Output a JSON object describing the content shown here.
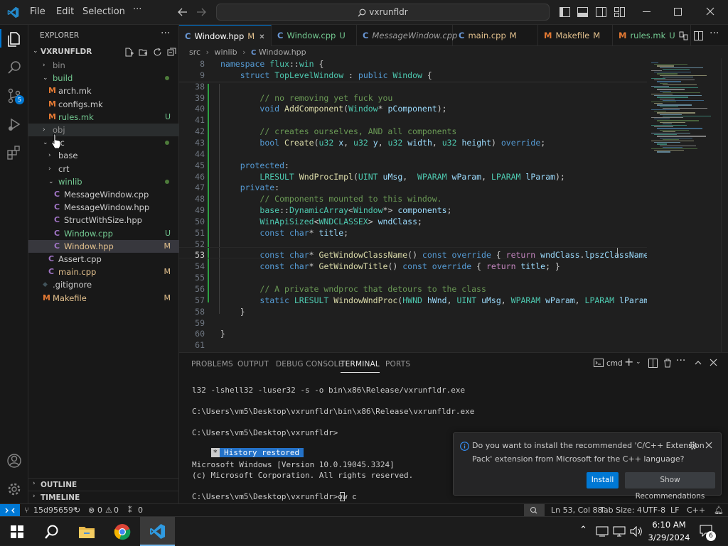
{
  "menu": {
    "file": "File",
    "edit": "Edit",
    "selection": "Selection",
    "more": "···"
  },
  "command_center": "vxrunfldr",
  "sidebar": {
    "title": "EXPLORER",
    "root": "VXRUNFLDR",
    "tree": [
      {
        "label": "bin",
        "type": "folder",
        "open": false,
        "indent": 1,
        "color": "#8c8c8c"
      },
      {
        "label": "build",
        "type": "folder",
        "open": true,
        "indent": 1,
        "color": "#73c991",
        "dot": true
      },
      {
        "label": "arch.mk",
        "type": "file",
        "icon": "M",
        "indent": 2,
        "color": "#cccccc"
      },
      {
        "label": "configs.mk",
        "type": "file",
        "icon": "M",
        "indent": 2,
        "color": "#cccccc"
      },
      {
        "label": "rules.mk",
        "type": "file",
        "icon": "M",
        "indent": 2,
        "color": "#73c991",
        "badge": "U"
      },
      {
        "label": "obj",
        "type": "folder",
        "open": false,
        "indent": 1,
        "color": "#8c8c8c",
        "hover": true
      },
      {
        "label": "src",
        "type": "folder",
        "open": true,
        "indent": 1,
        "color": "#cccccc",
        "dot": true
      },
      {
        "label": "base",
        "type": "folder",
        "open": false,
        "indent": 2,
        "color": "#cccccc"
      },
      {
        "label": "crt",
        "type": "folder",
        "open": false,
        "indent": 2,
        "color": "#cccccc"
      },
      {
        "label": "winlib",
        "type": "folder",
        "open": true,
        "indent": 2,
        "color": "#73c991",
        "dot": true
      },
      {
        "label": "MessageWindow.cpp",
        "type": "file",
        "icon": "C",
        "indent": 3,
        "color": "#cccccc"
      },
      {
        "label": "MessageWindow.hpp",
        "type": "file",
        "icon": "C",
        "indent": 3,
        "color": "#cccccc"
      },
      {
        "label": "StructWithSize.hpp",
        "type": "file",
        "icon": "C",
        "indent": 3,
        "color": "#cccccc"
      },
      {
        "label": "Window.cpp",
        "type": "file",
        "icon": "C",
        "indent": 3,
        "color": "#73c991",
        "badge": "U"
      },
      {
        "label": "Window.hpp",
        "type": "file",
        "icon": "C",
        "indent": 3,
        "color": "#e2c08d",
        "badge": "M",
        "selected": true
      },
      {
        "label": "Assert.cpp",
        "type": "file",
        "icon": "C",
        "indent": 2,
        "color": "#cccccc"
      },
      {
        "label": "main.cpp",
        "type": "file",
        "icon": "C",
        "indent": 2,
        "color": "#e2c08d",
        "badge": "M"
      },
      {
        "label": ".gitignore",
        "type": "file",
        "icon": "◆",
        "indent": 1,
        "color": "#cccccc"
      },
      {
        "label": "Makefile",
        "type": "file",
        "icon": "M",
        "indent": 1,
        "color": "#e2c08d",
        "badge": "M"
      }
    ],
    "outline": "OUTLINE",
    "timeline": "TIMELINE"
  },
  "tabs": [
    {
      "label": "Window.hpp",
      "badge": "M",
      "icon": "C",
      "active": true,
      "italic": false,
      "color": "#e2c08d"
    },
    {
      "label": "Window.cpp",
      "badge": "U",
      "icon": "C",
      "active": false,
      "italic": false,
      "color": "#73c991"
    },
    {
      "label": "MessageWindow.cpp",
      "badge": "",
      "icon": "C",
      "active": false,
      "italic": true,
      "color": "#9d9d9d"
    },
    {
      "label": "main.cpp",
      "badge": "M",
      "icon": "C",
      "active": false,
      "italic": false,
      "color": "#e2c08d"
    },
    {
      "label": "Makefile",
      "badge": "M",
      "icon": "M",
      "active": false,
      "italic": false,
      "color": "#e2c08d"
    },
    {
      "label": "rules.mk",
      "badge": "U",
      "icon": "M",
      "active": false,
      "italic": false,
      "color": "#73c991"
    }
  ],
  "breadcrumb": [
    "src",
    "winlib",
    "Window.hpp"
  ],
  "code_lines": [
    {
      "n": "8",
      "html": "<span class='k'>namespace</span> <span class='t'>flux</span>::<span class='t'>win</span> {"
    },
    {
      "n": "9",
      "html": "    <span class='k'>struct</span> <span class='t'>TopLevelWindow</span> : <span class='k'>public</span> <span class='t'>Window</span> {"
    },
    {
      "n": "38",
      "html": ""
    },
    {
      "n": "39",
      "html": "        <span class='c'>// no removing yet fuck you</span>"
    },
    {
      "n": "40",
      "html": "        <span class='k'>void</span> <span class='f'>AddComponent</span>(<span class='t'>Window</span>* <span class='v'>pComponent</span>);"
    },
    {
      "n": "41",
      "html": ""
    },
    {
      "n": "42",
      "html": "        <span class='c'>// creates ourselves, AND all components</span>"
    },
    {
      "n": "43",
      "html": "        <span class='k'>bool</span> <span class='f'>Create</span>(<span class='t'>u32</span> <span class='v'>x</span>, <span class='t'>u32</span> <span class='v'>y</span>, <span class='t'>u32</span> <span class='v'>width</span>, <span class='t'>u32</span> <span class='v'>height</span>) <span class='k'>override</span>;"
    },
    {
      "n": "44",
      "html": ""
    },
    {
      "n": "45",
      "html": "    <span class='k'>protected</span>:"
    },
    {
      "n": "46",
      "html": "        <span class='t'>LRESULT</span> <span class='f'>WndProcImpl</span>(<span class='t'>UINT</span> <span class='v'>uMsg</span>,  <span class='t'>WPARAM</span> <span class='v'>wParam</span>, <span class='t'>LPARAM</span> <span class='v'>lParam</span>);"
    },
    {
      "n": "47",
      "html": "    <span class='k'>private</span>:"
    },
    {
      "n": "48",
      "html": "        <span class='c'>// Components mounted to this window.</span>"
    },
    {
      "n": "49",
      "html": "        <span class='t'>base</span>::<span class='t'>DynamicArray</span>&lt;<span class='t'>Window</span>*&gt; <span class='v'>components</span>;"
    },
    {
      "n": "50",
      "html": "        <span class='t'>WinApiSized</span>&lt;<span class='t'>WNDCLASSEX</span>&gt; <span class='v'>wndClass</span>;"
    },
    {
      "n": "51",
      "html": "        <span class='k'>const</span> <span class='k'>char</span>* <span class='v'>title</span>;"
    },
    {
      "n": "52",
      "html": ""
    },
    {
      "n": "53",
      "html": "        <span class='k'>const</span> <span class='k'>char</span>* <span class='f'>GetWindowClassName</span>() <span class='k'>const</span> <span class='k'>override</span> { <span class='p'>return</span> <span class='v'>wndClass</span>.<span class='v'>lpszClassName</span>; }"
    },
    {
      "n": "54",
      "html": "        <span class='k'>const</span> <span class='k'>char</span>* <span class='f'>GetWindowTitle</span>() <span class='k'>const</span> <span class='k'>override</span> { <span class='p'>return</span> <span class='v'>title</span>; }"
    },
    {
      "n": "55",
      "html": ""
    },
    {
      "n": "56",
      "html": "        <span class='c'>// A private wndproc that detours to the class</span>"
    },
    {
      "n": "57",
      "html": "        <span class='k'>static</span> <span class='t'>LRESULT</span> <span class='f'>WindowWndProc</span>(<span class='t'>HWND</span> <span class='v'>hWnd</span>, <span class='t'>UINT</span> <span class='v'>uMsg</span>, <span class='t'>WPARAM</span> <span class='v'>wParam</span>, <span class='t'>LPARAM</span> <span class='v'>lParam</span>);"
    },
    {
      "n": "58",
      "html": "    }"
    },
    {
      "n": "59",
      "html": ""
    },
    {
      "n": "60",
      "html": "}"
    },
    {
      "n": "61",
      "html": ""
    }
  ],
  "panel": {
    "tabs": [
      "PROBLEMS",
      "OUTPUT",
      "DEBUG CONSOLE",
      "TERMINAL",
      "PORTS"
    ],
    "active": "TERMINAL",
    "shell": "cmd",
    "terminal_lines": [
      "l32 -lshell32 -luser32 -s -o bin\\x86\\Release/vxrunfldr.exe",
      "",
      "C:\\Users\\vm5\\Desktop\\vxrunfldr\\bin\\x86\\Release\\vxrunfldr.exe",
      "",
      "C:\\Users\\vm5\\Desktop\\vxrunfldr>",
      "",
      "",
      "Microsoft Windows [Version 10.0.19045.3324]",
      "(c) Microsoft Corporation. All rights reserved.",
      "",
      "C:\\Users\\vm5\\Desktop\\vxrunfldr>ow c"
    ],
    "history_star": "*",
    "history_label": "History restored"
  },
  "notification": {
    "message_line1": "Do you want to install the recommended 'C/C++ Extension",
    "message_line2": "Pack' extension from Microsoft for the C++ language?",
    "install": "Install",
    "recommend": "Show Recommendations"
  },
  "status": {
    "branch": "15d95659*",
    "errors": "0",
    "warnings": "0",
    "ports": "0",
    "position": "Ln 53, Col 88",
    "tabsize": "Tab Size: 4",
    "encoding": "UTF-8",
    "eol": "LF",
    "language": "C++"
  },
  "taskbar": {
    "time": "6:10 AM",
    "date": "3/29/2024",
    "notifications": "6"
  },
  "colors": {
    "accent": "#0078d4",
    "modified": "#e2c08d",
    "untracked": "#73c991"
  }
}
